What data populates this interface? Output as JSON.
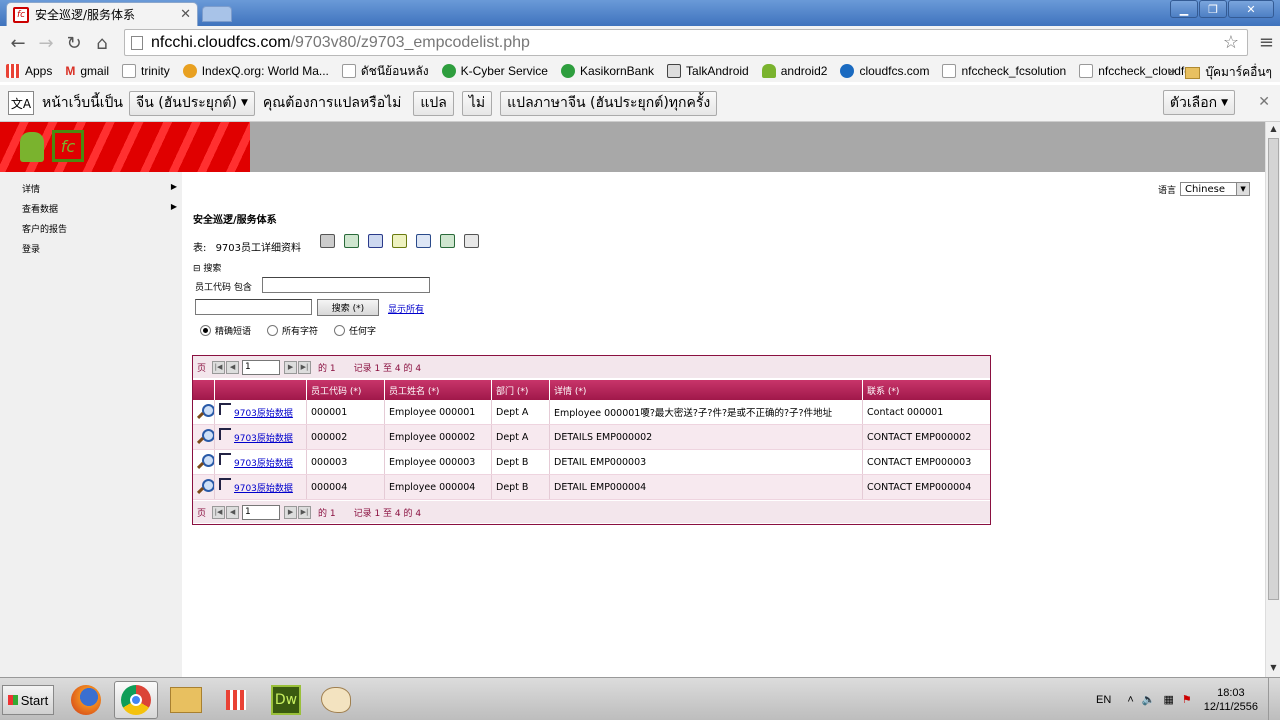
{
  "browser": {
    "tab_title": "安全巡逻/服务体系",
    "tab_fav": "fc",
    "url_host": "nfcchi.cloudfcs.com",
    "url_path": "/9703v80/z9703_empcodelist.php"
  },
  "bookmarks": [
    {
      "label": "Apps",
      "color": "#e94235"
    },
    {
      "label": "gmail",
      "color": "#d93025"
    },
    {
      "label": "trinity",
      "color": "#999999"
    },
    {
      "label": "IndexQ.org: World Ma...",
      "color": "#e8a020"
    },
    {
      "label": "ดัชนีย้อนหลัง",
      "color": "#888888"
    },
    {
      "label": "K-Cyber Service",
      "color": "#2e9e3e"
    },
    {
      "label": "KasikornBank",
      "color": "#2e9e3e"
    },
    {
      "label": "TalkAndroid",
      "color": "#444444"
    },
    {
      "label": "android2",
      "color": "#7ab32e"
    },
    {
      "label": "cloudfcs.com",
      "color": "#1a6ac0"
    },
    {
      "label": "nfccheck_fcsolution",
      "color": "#888888"
    },
    {
      "label": "nfccheck_cloudfcs",
      "color": "#888888"
    }
  ],
  "bookmarks_overflow": "»",
  "bookmarks_folder": "บุ๊คมาร์คอื่นๆ",
  "translate": {
    "prompt": "หน้าเว็บนี้เป็น",
    "language": "จีน (ฮันประยุกต์)",
    "question": "คุณต้องการแปลหรือไม่",
    "translate_btn": "แปล",
    "no_btn": "ไม่",
    "always_btn": "แปลภาษาจีน (ฮันประยุกต์)ทุกครั้ง",
    "options_btn": "ตัวเลือก"
  },
  "sidebar": {
    "items": [
      {
        "label": "详情",
        "arrow": "▶"
      },
      {
        "label": "查看数据",
        "arrow": "▶"
      },
      {
        "label": "客户的报告",
        "arrow": ""
      },
      {
        "label": "登录",
        "arrow": ""
      }
    ]
  },
  "lang": {
    "label": "语言",
    "value": "Chinese"
  },
  "main": {
    "title": "安全巡逻/服务体系",
    "table_label": "表:",
    "table_name": "9703员工详细资料",
    "search_head": "⊟ 搜索",
    "search_field_label": "员工代码 包含",
    "search_btn": "搜索 (*)",
    "show_all": "显示所有",
    "radio": [
      "精确短语",
      "所有字符",
      "任何字"
    ]
  },
  "grid": {
    "pager": {
      "page_label": "页",
      "page_value": "1",
      "of": "的 1",
      "records": "记录 1 至 4 的 4"
    },
    "columns": [
      "",
      "",
      "员工代码 (*)",
      "员工姓名 (*)",
      "部门 (*)",
      "详情 (*)",
      "联系 (*)"
    ],
    "link_label": "9703原始数据",
    "rows": [
      {
        "code": "000001",
        "name": "Employee 000001",
        "dept": "Dept A",
        "detail": "Employee 000001嗄?最大密送?子?件?是或不正确的?子?件地址",
        "contact": "Contact 000001"
      },
      {
        "code": "000002",
        "name": "Employee 000002",
        "dept": "Dept A",
        "detail": "DETAILS EMP000002",
        "contact": "CONTACT EMP000002"
      },
      {
        "code": "000003",
        "name": "Employee 000003",
        "dept": "Dept B",
        "detail": "DETAIL EMP000003",
        "contact": "CONTACT EMP000003"
      },
      {
        "code": "000004",
        "name": "Employee 000004",
        "dept": "Dept B",
        "detail": "DETAIL EMP000004",
        "contact": "CONTACT EMP000004"
      }
    ]
  },
  "taskbar": {
    "start": "Start",
    "lang": "EN",
    "time": "18:03",
    "date": "12/11/2556",
    "dw_label": "Dw"
  }
}
